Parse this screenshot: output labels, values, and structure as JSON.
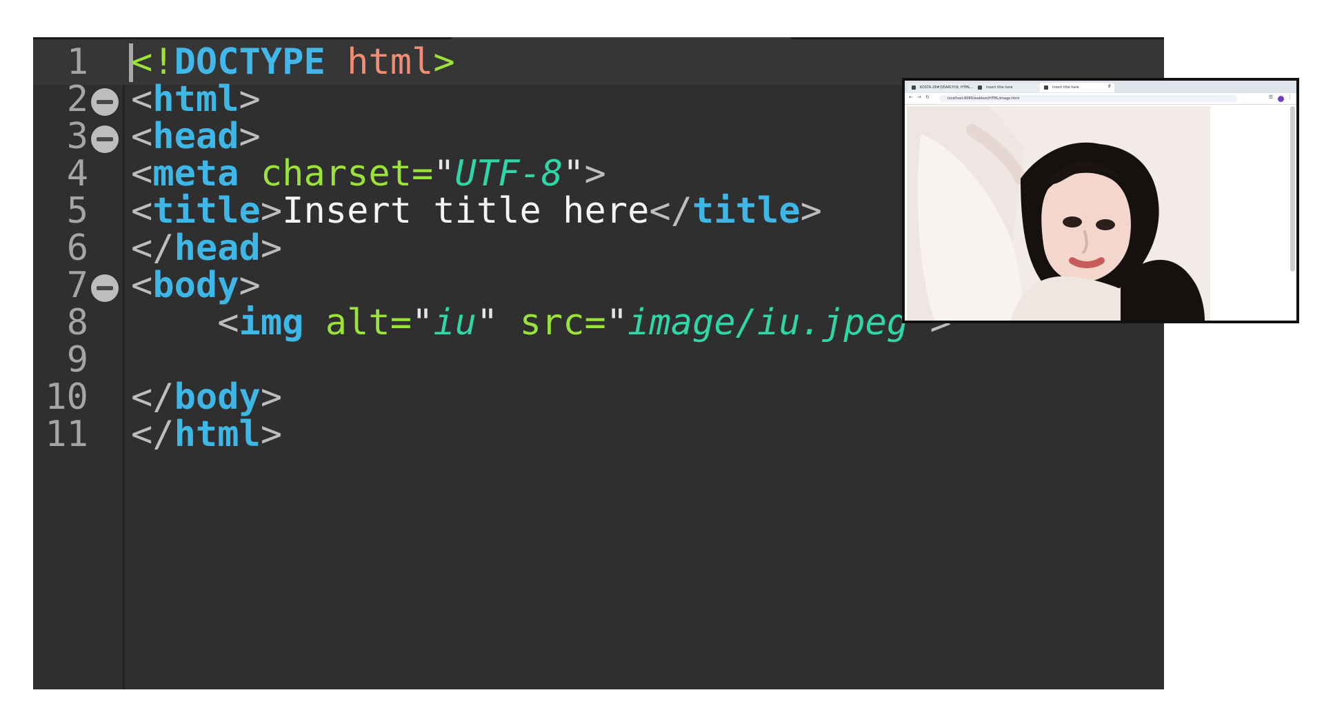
{
  "editor": {
    "lines": [
      {
        "n": "1"
      },
      {
        "n": "2"
      },
      {
        "n": "3"
      },
      {
        "n": "4"
      },
      {
        "n": "5"
      },
      {
        "n": "6"
      },
      {
        "n": "7"
      },
      {
        "n": "8"
      },
      {
        "n": "9"
      },
      {
        "n": "10"
      },
      {
        "n": "11"
      }
    ],
    "code": {
      "l1": {
        "lt": "<",
        "bang": "!",
        "doctype": "DOCTYPE",
        "space": " ",
        "html": "html",
        "gt": ">"
      },
      "l2": {
        "lt": "<",
        "tag": "html",
        "gt": ">"
      },
      "l3": {
        "lt": "<",
        "tag": "head",
        "gt": ">"
      },
      "l4": {
        "lt": "<",
        "tag": "meta",
        "sp": " ",
        "attr": "charset=",
        "q1": "\"",
        "val": "UTF-8",
        "q2": "\"",
        "gt": ">"
      },
      "l5": {
        "lt": "<",
        "tag": "title",
        "gt": ">",
        "text": "Insert title here",
        "lt2": "</",
        "tag2": "title",
        "gt2": ">"
      },
      "l6": {
        "lt": "</",
        "tag": "head",
        "gt": ">"
      },
      "l7": {
        "lt": "<",
        "tag": "body",
        "gt": ">"
      },
      "l8": {
        "indent": "    ",
        "lt": "<",
        "tag": "img",
        "sp": " ",
        "attr1": "alt=",
        "q1": "\"",
        "val1": "iu",
        "q2": "\"",
        "sp2": " ",
        "attr2": "src=",
        "q3": "\"",
        "val2": "image/iu.jpeg",
        "q4": "\"",
        "gt": ">"
      },
      "l10": {
        "lt": "</",
        "tag": "body",
        "gt": ">"
      },
      "l11": {
        "lt": "</",
        "tag": "html",
        "gt": ">"
      }
    }
  },
  "preview": {
    "tabs": [
      "KOSTA-28#(SEARCH)8, HTML…",
      "Insert title here",
      "Insert title here"
    ],
    "url": "localhost:8080/webtest/HTML/image.html",
    "new_tab": "+"
  }
}
